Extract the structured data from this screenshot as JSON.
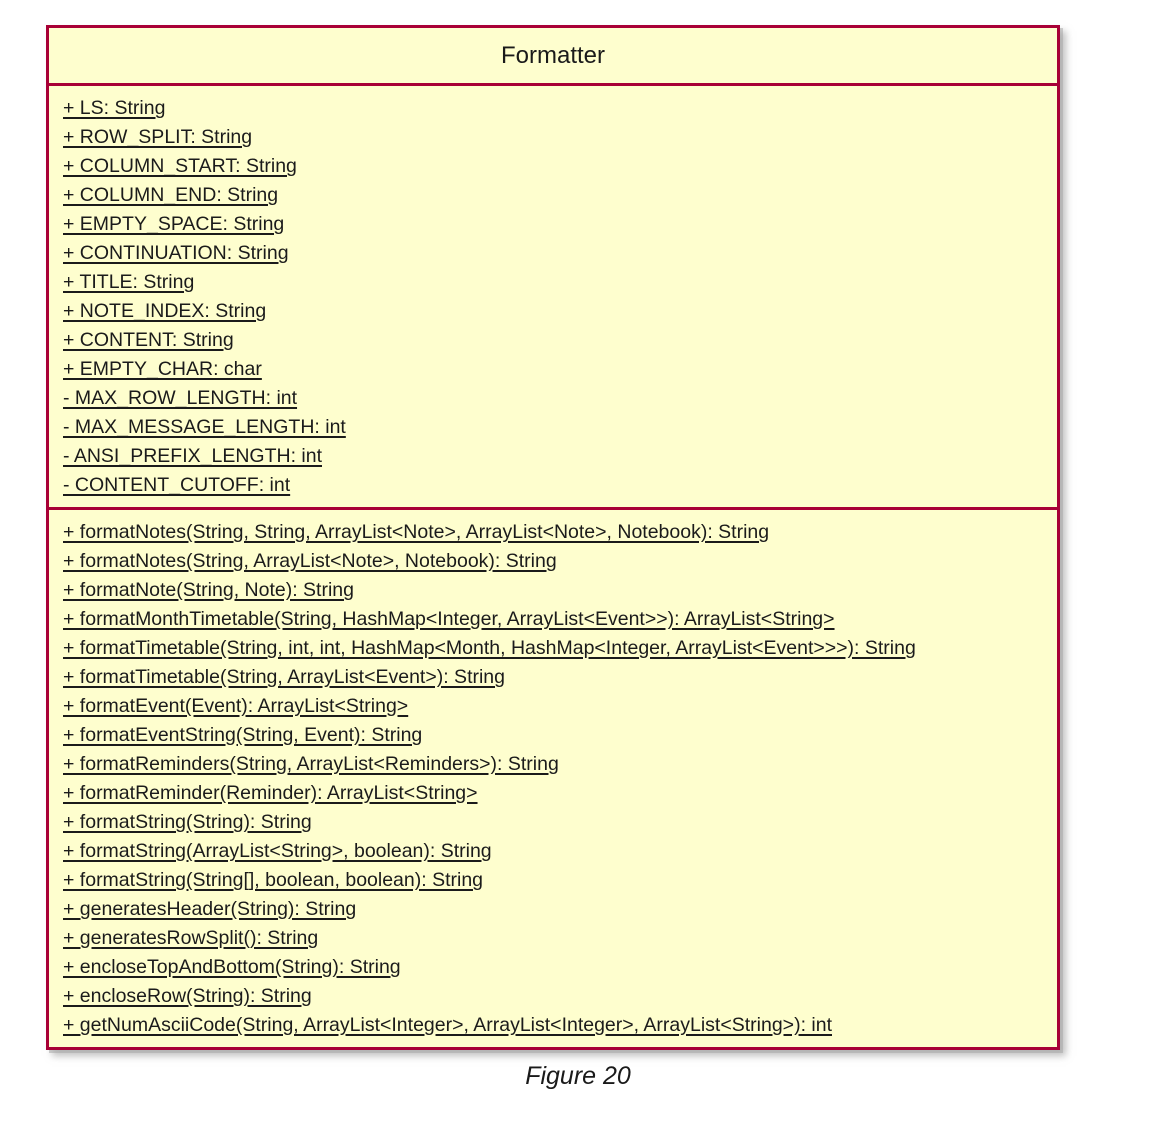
{
  "figure": {
    "caption": "Figure 20",
    "diagram_type": "uml-class-diagram"
  },
  "colors": {
    "class_fill": "#FEFECE",
    "class_border": "#A80036",
    "text": "#1b1b1b",
    "page_background": "#FFFFFF",
    "shadow": "#AAAAAA"
  },
  "uml_class": {
    "name": "Formatter",
    "attributes": [
      {
        "visibility": "+",
        "text": "+ LS: String",
        "name": "LS",
        "type": "String",
        "static": true
      },
      {
        "visibility": "+",
        "text": "+ ROW_SPLIT: String",
        "name": "ROW_SPLIT",
        "type": "String",
        "static": true
      },
      {
        "visibility": "+",
        "text": "+ COLUMN_START: String",
        "name": "COLUMN_START",
        "type": "String",
        "static": true
      },
      {
        "visibility": "+",
        "text": "+ COLUMN_END: String",
        "name": "COLUMN_END",
        "type": "String",
        "static": true
      },
      {
        "visibility": "+",
        "text": "+ EMPTY_SPACE: String",
        "name": "EMPTY_SPACE",
        "type": "String",
        "static": true
      },
      {
        "visibility": "+",
        "text": "+ CONTINUATION: String",
        "name": "CONTINUATION",
        "type": "String",
        "static": true
      },
      {
        "visibility": "+",
        "text": "+ TITLE: String",
        "name": "TITLE",
        "type": "String",
        "static": true
      },
      {
        "visibility": "+",
        "text": "+ NOTE_INDEX: String",
        "name": "NOTE_INDEX",
        "type": "String",
        "static": true
      },
      {
        "visibility": "+",
        "text": "+ CONTENT: String",
        "name": "CONTENT",
        "type": "String",
        "static": true
      },
      {
        "visibility": "+",
        "text": "+ EMPTY_CHAR: char",
        "name": "EMPTY_CHAR",
        "type": "char",
        "static": true
      },
      {
        "visibility": "-",
        "text": "- MAX_ROW_LENGTH: int",
        "name": "MAX_ROW_LENGTH",
        "type": "int",
        "static": true
      },
      {
        "visibility": "-",
        "text": "- MAX_MESSAGE_LENGTH: int",
        "name": "MAX_MESSAGE_LENGTH",
        "type": "int",
        "static": true
      },
      {
        "visibility": "-",
        "text": "- ANSI_PREFIX_LENGTH: int",
        "name": "ANSI_PREFIX_LENGTH",
        "type": "int",
        "static": true
      },
      {
        "visibility": "-",
        "text": "- CONTENT_CUTOFF: int",
        "name": "CONTENT_CUTOFF",
        "type": "int",
        "static": true
      }
    ],
    "methods": [
      {
        "visibility": "+",
        "text": "+ formatNotes(String, String, ArrayList<Note>, ArrayList<Note>, Notebook): String",
        "name": "formatNotes",
        "returns": "String",
        "static": true
      },
      {
        "visibility": "+",
        "text": "+ formatNotes(String, ArrayList<Note>, Notebook): String",
        "name": "formatNotes",
        "returns": "String",
        "static": true
      },
      {
        "visibility": "+",
        "text": "+ formatNote(String, Note): String",
        "name": "formatNote",
        "returns": "String",
        "static": true
      },
      {
        "visibility": "+",
        "text": "+ formatMonthTimetable(String, HashMap<Integer, ArrayList<Event>>): ArrayList<String>",
        "name": "formatMonthTimetable",
        "returns": "ArrayList<String>",
        "static": true
      },
      {
        "visibility": "+",
        "text": "+ formatTimetable(String, int, int, HashMap<Month, HashMap<Integer, ArrayList<Event>>>): String",
        "name": "formatTimetable",
        "returns": "String",
        "static": true
      },
      {
        "visibility": "+",
        "text": "+ formatTimetable(String, ArrayList<Event>): String",
        "name": "formatTimetable",
        "returns": "String",
        "static": true
      },
      {
        "visibility": "+",
        "text": "+ formatEvent(Event): ArrayList<String>",
        "name": "formatEvent",
        "returns": "ArrayList<String>",
        "static": true
      },
      {
        "visibility": "+",
        "text": "+ formatEventString(String, Event): String",
        "name": "formatEventString",
        "returns": "String",
        "static": true
      },
      {
        "visibility": "+",
        "text": "+ formatReminders(String, ArrayList<Reminders>): String",
        "name": "formatReminders",
        "returns": "String",
        "static": true
      },
      {
        "visibility": "+",
        "text": "+ formatReminder(Reminder): ArrayList<String>",
        "name": "formatReminder",
        "returns": "ArrayList<String>",
        "static": true
      },
      {
        "visibility": "+",
        "text": "+ formatString(String): String",
        "name": "formatString",
        "returns": "String",
        "static": true
      },
      {
        "visibility": "+",
        "text": "+ formatString(ArrayList<String>, boolean): String",
        "name": "formatString",
        "returns": "String",
        "static": true
      },
      {
        "visibility": "+",
        "text": "+ formatString(String[], boolean, boolean): String",
        "name": "formatString",
        "returns": "String",
        "static": true
      },
      {
        "visibility": "+",
        "text": "+ generatesHeader(String): String",
        "name": "generatesHeader",
        "returns": "String",
        "static": true
      },
      {
        "visibility": "+",
        "text": "+ generatesRowSplit(): String",
        "name": "generatesRowSplit",
        "returns": "String",
        "static": true
      },
      {
        "visibility": "+",
        "text": "+ encloseTopAndBottom(String): String",
        "name": "encloseTopAndBottom",
        "returns": "String",
        "static": true
      },
      {
        "visibility": "+",
        "text": "+ encloseRow(String): String",
        "name": "encloseRow",
        "returns": "String",
        "static": true
      },
      {
        "visibility": "+",
        "text": "+ getNumAsciiCode(String, ArrayList<Integer>, ArrayList<Integer>, ArrayList<String>): int",
        "name": "getNumAsciiCode",
        "returns": "int",
        "static": true
      }
    ]
  }
}
